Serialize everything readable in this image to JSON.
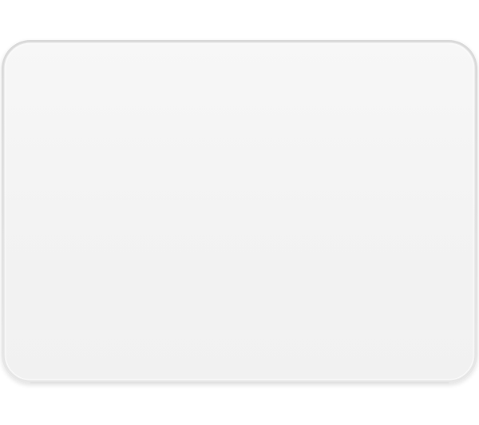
{
  "product": {
    "name_icon": "trackpad-device",
    "surface_color": "#f4f4f4",
    "edge_color": "#e2e2e2",
    "rim_color": "#cfcfcf",
    "background_color": "#ffffff"
  }
}
